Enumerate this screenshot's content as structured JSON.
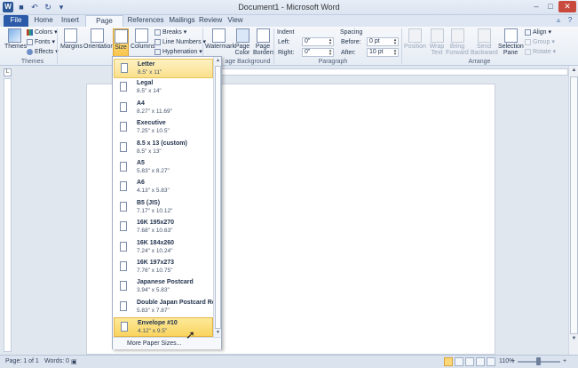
{
  "window": {
    "title": "Document1 - Microsoft Word"
  },
  "tabs": [
    "File",
    "Home",
    "Insert",
    "Page Layout",
    "References",
    "Mailings",
    "Review",
    "View"
  ],
  "active_tab": "Page Layout",
  "ribbon": {
    "themes": {
      "themes_label": "Themes",
      "colors_label": "Colors",
      "fonts_label": "Fonts",
      "effects_label": "Effects",
      "group_label": "Themes"
    },
    "page_setup": {
      "margins_label": "Margins",
      "orientation_label": "Orientation",
      "size_label": "Size",
      "columns_label": "Columns",
      "breaks_label": "Breaks",
      "line_numbers_label": "Line Numbers",
      "hyphenation_label": "Hyphenation"
    },
    "page_background": {
      "watermark_label": "Watermark",
      "page_color_label": "Page Color",
      "page_borders_label": "Page Borders",
      "group_label": "age Background"
    },
    "paragraph": {
      "indent_label": "Indent",
      "left_label": "Left:",
      "left_value": "0\"",
      "right_label": "Right:",
      "right_value": "0\"",
      "spacing_label": "Spacing",
      "before_label": "Before:",
      "before_value": "0 pt",
      "after_label": "After:",
      "after_value": "10 pt",
      "group_label": "Paragraph"
    },
    "arrange": {
      "position_label": "Position",
      "wrap_text_label": "Wrap Text",
      "bring_forward_label": "Bring Forward",
      "send_backward_label": "Send Backward",
      "selection_pane_label": "Selection Pane",
      "align_label": "Align",
      "group_label_btn": "Group",
      "rotate_label": "Rotate",
      "group_label": "Arrange"
    }
  },
  "size_menu": {
    "items": [
      {
        "name": "Letter",
        "dims": "8.5\" x 11\""
      },
      {
        "name": "Legal",
        "dims": "8.5\" x 14\""
      },
      {
        "name": "A4",
        "dims": "8.27\" x 11.69\""
      },
      {
        "name": "Executive",
        "dims": "7.25\" x 10.5\""
      },
      {
        "name": "8.5 x 13 (custom)",
        "dims": "8.5\" x 13\""
      },
      {
        "name": "A5",
        "dims": "5.83\" x 8.27\""
      },
      {
        "name": "A6",
        "dims": "4.13\" x 5.83\""
      },
      {
        "name": "B5 (JIS)",
        "dims": "7.17\" x 10.12\""
      },
      {
        "name": "16K 195x270",
        "dims": "7.68\" x 10.63\""
      },
      {
        "name": "16K 184x260",
        "dims": "7.24\" x 10.24\""
      },
      {
        "name": "16K 197x273",
        "dims": "7.76\" x 10.75\""
      },
      {
        "name": "Japanese Postcard",
        "dims": "3.94\" x 5.83\""
      },
      {
        "name": "Double Japan Postcard Rotated",
        "dims": "5.83\" x 7.87\""
      },
      {
        "name": "Envelope #10",
        "dims": "4.12\" x 9.5\""
      }
    ],
    "selected": "Letter",
    "hovered": "Envelope #10",
    "more_label": "More Paper Sizes..."
  },
  "status": {
    "page": "Page: 1 of 1",
    "words": "Words: 0",
    "zoom": "110%"
  }
}
